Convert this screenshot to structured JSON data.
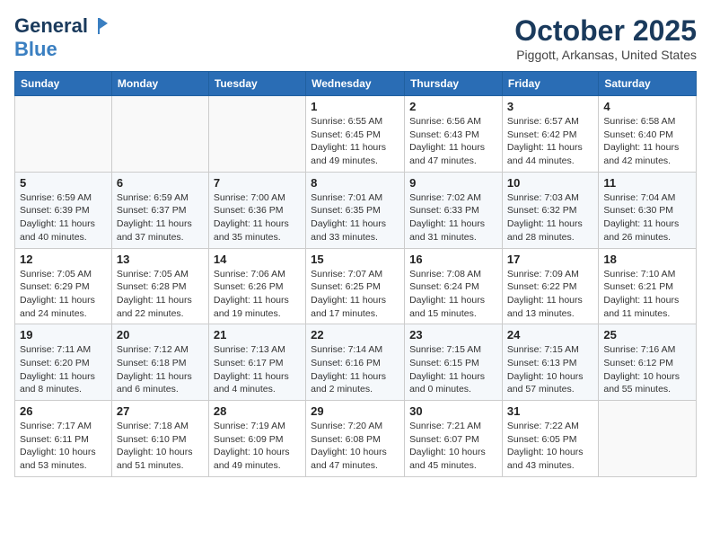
{
  "header": {
    "logo_line1": "General",
    "logo_line2": "Blue",
    "month": "October 2025",
    "location": "Piggott, Arkansas, United States"
  },
  "weekdays": [
    "Sunday",
    "Monday",
    "Tuesday",
    "Wednesday",
    "Thursday",
    "Friday",
    "Saturday"
  ],
  "weeks": [
    [
      {
        "day": "",
        "info": ""
      },
      {
        "day": "",
        "info": ""
      },
      {
        "day": "",
        "info": ""
      },
      {
        "day": "1",
        "info": "Sunrise: 6:55 AM\nSunset: 6:45 PM\nDaylight: 11 hours\nand 49 minutes."
      },
      {
        "day": "2",
        "info": "Sunrise: 6:56 AM\nSunset: 6:43 PM\nDaylight: 11 hours\nand 47 minutes."
      },
      {
        "day": "3",
        "info": "Sunrise: 6:57 AM\nSunset: 6:42 PM\nDaylight: 11 hours\nand 44 minutes."
      },
      {
        "day": "4",
        "info": "Sunrise: 6:58 AM\nSunset: 6:40 PM\nDaylight: 11 hours\nand 42 minutes."
      }
    ],
    [
      {
        "day": "5",
        "info": "Sunrise: 6:59 AM\nSunset: 6:39 PM\nDaylight: 11 hours\nand 40 minutes."
      },
      {
        "day": "6",
        "info": "Sunrise: 6:59 AM\nSunset: 6:37 PM\nDaylight: 11 hours\nand 37 minutes."
      },
      {
        "day": "7",
        "info": "Sunrise: 7:00 AM\nSunset: 6:36 PM\nDaylight: 11 hours\nand 35 minutes."
      },
      {
        "day": "8",
        "info": "Sunrise: 7:01 AM\nSunset: 6:35 PM\nDaylight: 11 hours\nand 33 minutes."
      },
      {
        "day": "9",
        "info": "Sunrise: 7:02 AM\nSunset: 6:33 PM\nDaylight: 11 hours\nand 31 minutes."
      },
      {
        "day": "10",
        "info": "Sunrise: 7:03 AM\nSunset: 6:32 PM\nDaylight: 11 hours\nand 28 minutes."
      },
      {
        "day": "11",
        "info": "Sunrise: 7:04 AM\nSunset: 6:30 PM\nDaylight: 11 hours\nand 26 minutes."
      }
    ],
    [
      {
        "day": "12",
        "info": "Sunrise: 7:05 AM\nSunset: 6:29 PM\nDaylight: 11 hours\nand 24 minutes."
      },
      {
        "day": "13",
        "info": "Sunrise: 7:05 AM\nSunset: 6:28 PM\nDaylight: 11 hours\nand 22 minutes."
      },
      {
        "day": "14",
        "info": "Sunrise: 7:06 AM\nSunset: 6:26 PM\nDaylight: 11 hours\nand 19 minutes."
      },
      {
        "day": "15",
        "info": "Sunrise: 7:07 AM\nSunset: 6:25 PM\nDaylight: 11 hours\nand 17 minutes."
      },
      {
        "day": "16",
        "info": "Sunrise: 7:08 AM\nSunset: 6:24 PM\nDaylight: 11 hours\nand 15 minutes."
      },
      {
        "day": "17",
        "info": "Sunrise: 7:09 AM\nSunset: 6:22 PM\nDaylight: 11 hours\nand 13 minutes."
      },
      {
        "day": "18",
        "info": "Sunrise: 7:10 AM\nSunset: 6:21 PM\nDaylight: 11 hours\nand 11 minutes."
      }
    ],
    [
      {
        "day": "19",
        "info": "Sunrise: 7:11 AM\nSunset: 6:20 PM\nDaylight: 11 hours\nand 8 minutes."
      },
      {
        "day": "20",
        "info": "Sunrise: 7:12 AM\nSunset: 6:18 PM\nDaylight: 11 hours\nand 6 minutes."
      },
      {
        "day": "21",
        "info": "Sunrise: 7:13 AM\nSunset: 6:17 PM\nDaylight: 11 hours\nand 4 minutes."
      },
      {
        "day": "22",
        "info": "Sunrise: 7:14 AM\nSunset: 6:16 PM\nDaylight: 11 hours\nand 2 minutes."
      },
      {
        "day": "23",
        "info": "Sunrise: 7:15 AM\nSunset: 6:15 PM\nDaylight: 11 hours\nand 0 minutes."
      },
      {
        "day": "24",
        "info": "Sunrise: 7:15 AM\nSunset: 6:13 PM\nDaylight: 10 hours\nand 57 minutes."
      },
      {
        "day": "25",
        "info": "Sunrise: 7:16 AM\nSunset: 6:12 PM\nDaylight: 10 hours\nand 55 minutes."
      }
    ],
    [
      {
        "day": "26",
        "info": "Sunrise: 7:17 AM\nSunset: 6:11 PM\nDaylight: 10 hours\nand 53 minutes."
      },
      {
        "day": "27",
        "info": "Sunrise: 7:18 AM\nSunset: 6:10 PM\nDaylight: 10 hours\nand 51 minutes."
      },
      {
        "day": "28",
        "info": "Sunrise: 7:19 AM\nSunset: 6:09 PM\nDaylight: 10 hours\nand 49 minutes."
      },
      {
        "day": "29",
        "info": "Sunrise: 7:20 AM\nSunset: 6:08 PM\nDaylight: 10 hours\nand 47 minutes."
      },
      {
        "day": "30",
        "info": "Sunrise: 7:21 AM\nSunset: 6:07 PM\nDaylight: 10 hours\nand 45 minutes."
      },
      {
        "day": "31",
        "info": "Sunrise: 7:22 AM\nSunset: 6:05 PM\nDaylight: 10 hours\nand 43 minutes."
      },
      {
        "day": "",
        "info": ""
      }
    ]
  ]
}
